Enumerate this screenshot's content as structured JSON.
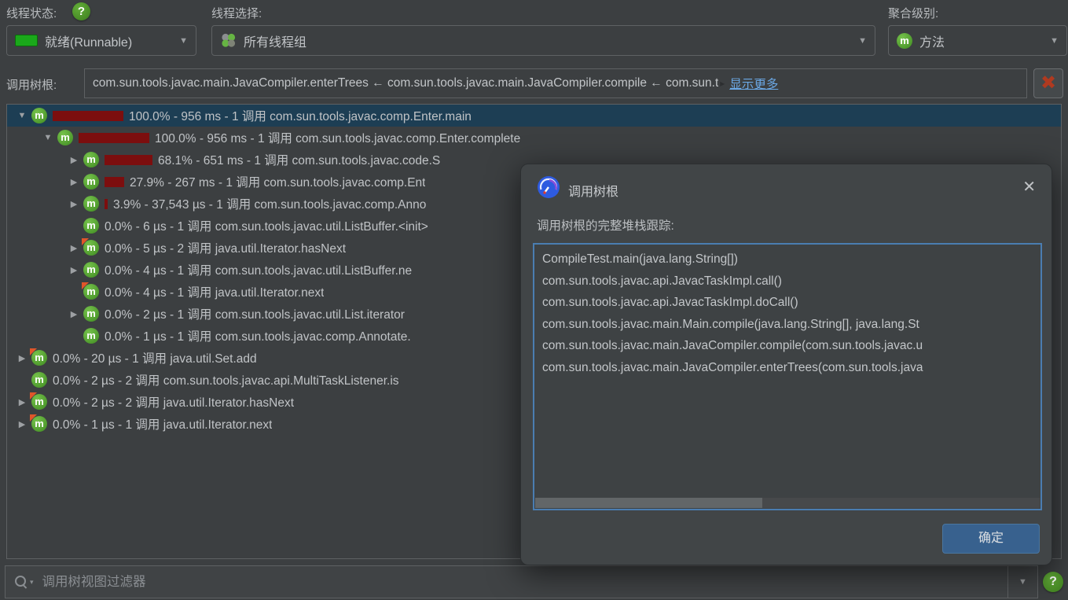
{
  "toolbar": {
    "thread_status_label": "线程状态:",
    "thread_status_value": "就绪(Runnable)",
    "thread_selection_label": "线程选择:",
    "thread_selection_value": "所有线程组",
    "aggregation_label": "聚合级别:",
    "aggregation_value": "方法",
    "call_tree_root_label": "调用树根:",
    "call_tree_root_value": "com.sun.tools.javac.main.JavaCompiler.enterTrees ← com.sun.tools.javac.main.JavaCompiler.compile ← com.sun.t",
    "show_more_label": "显示更多"
  },
  "icons": {
    "help": "?",
    "dropdown_arrow": "▼",
    "root_expander": "▸",
    "clear": "✖",
    "close": "✕",
    "search_caret": "▾",
    "method_letter": "m"
  },
  "tree": {
    "rows": [
      {
        "level": 0,
        "expand": "expanded",
        "orange": false,
        "pct": 100.0,
        "selected": true,
        "label": "100.0% - 956 ms - 1 调用 com.sun.tools.javac.comp.Enter.main"
      },
      {
        "level": 1,
        "expand": "expanded",
        "orange": false,
        "pct": 100.0,
        "selected": false,
        "label": "100.0% - 956 ms - 1 调用 com.sun.tools.javac.comp.Enter.complete"
      },
      {
        "level": 2,
        "expand": "collapsed",
        "orange": false,
        "pct": 68.1,
        "selected": false,
        "label": "68.1% - 651 ms - 1 调用 com.sun.tools.javac.code.S"
      },
      {
        "level": 2,
        "expand": "collapsed",
        "orange": false,
        "pct": 27.9,
        "selected": false,
        "label": "27.9% - 267 ms - 1 调用 com.sun.tools.javac.comp.Ent"
      },
      {
        "level": 2,
        "expand": "collapsed",
        "orange": false,
        "pct": 3.9,
        "selected": false,
        "label": "3.9% - 37,543 µs - 1 调用 com.sun.tools.javac.comp.Anno"
      },
      {
        "level": 2,
        "expand": "none",
        "orange": false,
        "pct": 0,
        "selected": false,
        "label": "0.0% - 6 µs - 1 调用 com.sun.tools.javac.util.ListBuffer.<init>"
      },
      {
        "level": 2,
        "expand": "collapsed",
        "orange": true,
        "pct": 0,
        "selected": false,
        "label": "0.0% - 5 µs - 2 调用 java.util.Iterator.hasNext"
      },
      {
        "level": 2,
        "expand": "collapsed",
        "orange": false,
        "pct": 0,
        "selected": false,
        "label": "0.0% - 4 µs - 1 调用 com.sun.tools.javac.util.ListBuffer.ne"
      },
      {
        "level": 2,
        "expand": "none",
        "orange": true,
        "pct": 0,
        "selected": false,
        "label": "0.0% - 4 µs - 1 调用 java.util.Iterator.next"
      },
      {
        "level": 2,
        "expand": "collapsed",
        "orange": false,
        "pct": 0,
        "selected": false,
        "label": "0.0% - 2 µs - 1 调用 com.sun.tools.javac.util.List.iterator"
      },
      {
        "level": 2,
        "expand": "none",
        "orange": false,
        "pct": 0,
        "selected": false,
        "label": "0.0% - 1 µs - 1 调用 com.sun.tools.javac.comp.Annotate."
      },
      {
        "level": 0,
        "expand": "collapsed",
        "orange": true,
        "pct": 0,
        "selected": false,
        "label": "0.0% - 20 µs - 1 调用 java.util.Set.add"
      },
      {
        "level": 0,
        "expand": "none",
        "orange": false,
        "pct": 0,
        "selected": false,
        "label": "0.0% - 2 µs - 2 调用 com.sun.tools.javac.api.MultiTaskListener.is"
      },
      {
        "level": 0,
        "expand": "collapsed",
        "orange": true,
        "pct": 0,
        "selected": false,
        "label": "0.0% - 2 µs - 2 调用 java.util.Iterator.hasNext"
      },
      {
        "level": 0,
        "expand": "collapsed",
        "orange": true,
        "pct": 0,
        "selected": false,
        "label": "0.0% - 1 µs - 1 调用 java.util.Iterator.next"
      }
    ]
  },
  "dialog": {
    "title": "调用树根",
    "subtitle": "调用树根的完整堆栈跟踪:",
    "stack": [
      "CompileTest.main(java.lang.String[])",
      "com.sun.tools.javac.api.JavacTaskImpl.call()",
      "com.sun.tools.javac.api.JavacTaskImpl.doCall()",
      "com.sun.tools.javac.main.Main.compile(java.lang.String[], java.lang.St",
      "com.sun.tools.javac.main.JavaCompiler.compile(com.sun.tools.javac.u",
      "com.sun.tools.javac.main.JavaCompiler.enterTrees(com.sun.tools.java"
    ],
    "ok_label": "确定"
  },
  "filter": {
    "placeholder": "调用树视图过滤器"
  },
  "colors": {
    "background": "#3c3f41",
    "dialog-background": "#414547",
    "border": "#5e6163",
    "text": "#c0c3c6",
    "selection": "#1d3e54",
    "bar": "#7c0e0e",
    "method-green": "#3f8b21",
    "orange": "#e0562a",
    "link": "#6ba8e5",
    "danger": "#b03a20",
    "ok-button": "#38618e",
    "focus-border": "#4a7db1"
  }
}
